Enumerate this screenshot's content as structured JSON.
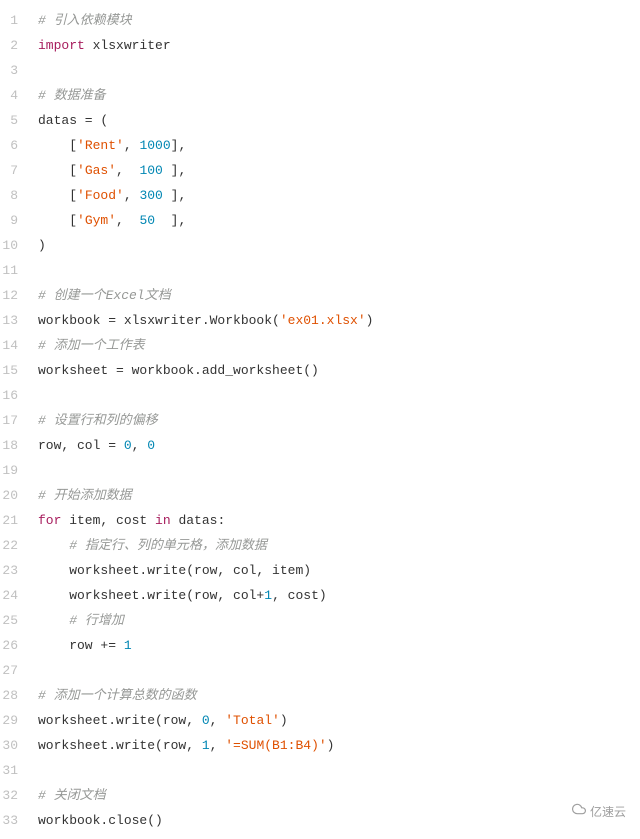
{
  "watermark": "亿速云",
  "lines": [
    {
      "n": 1,
      "tokens": [
        {
          "t": "# 引入依赖模块",
          "c": "c"
        }
      ]
    },
    {
      "n": 2,
      "tokens": [
        {
          "t": "import",
          "c": "k"
        },
        {
          "t": " xlsxwriter",
          "c": "p"
        }
      ]
    },
    {
      "n": 3,
      "tokens": []
    },
    {
      "n": 4,
      "tokens": [
        {
          "t": "# 数据准备",
          "c": "c"
        }
      ]
    },
    {
      "n": 5,
      "tokens": [
        {
          "t": "datas = (",
          "c": "p"
        }
      ]
    },
    {
      "n": 6,
      "tokens": [
        {
          "t": "    [",
          "c": "p"
        },
        {
          "t": "'Rent'",
          "c": "s"
        },
        {
          "t": ", ",
          "c": "p"
        },
        {
          "t": "1000",
          "c": "n"
        },
        {
          "t": "],",
          "c": "p"
        }
      ]
    },
    {
      "n": 7,
      "tokens": [
        {
          "t": "    [",
          "c": "p"
        },
        {
          "t": "'Gas'",
          "c": "s"
        },
        {
          "t": ",  ",
          "c": "p"
        },
        {
          "t": "100",
          "c": "n"
        },
        {
          "t": " ],",
          "c": "p"
        }
      ]
    },
    {
      "n": 8,
      "tokens": [
        {
          "t": "    [",
          "c": "p"
        },
        {
          "t": "'Food'",
          "c": "s"
        },
        {
          "t": ", ",
          "c": "p"
        },
        {
          "t": "300",
          "c": "n"
        },
        {
          "t": " ],",
          "c": "p"
        }
      ]
    },
    {
      "n": 9,
      "tokens": [
        {
          "t": "    [",
          "c": "p"
        },
        {
          "t": "'Gym'",
          "c": "s"
        },
        {
          "t": ",  ",
          "c": "p"
        },
        {
          "t": "50",
          "c": "n"
        },
        {
          "t": "  ],",
          "c": "p"
        }
      ]
    },
    {
      "n": 10,
      "tokens": [
        {
          "t": ")",
          "c": "p"
        }
      ]
    },
    {
      "n": 11,
      "tokens": []
    },
    {
      "n": 12,
      "tokens": [
        {
          "t": "# 创建一个Excel文档",
          "c": "c"
        }
      ]
    },
    {
      "n": 13,
      "tokens": [
        {
          "t": "workbook = xlsxwriter.Workbook(",
          "c": "p"
        },
        {
          "t": "'ex01.xlsx'",
          "c": "s"
        },
        {
          "t": ")",
          "c": "p"
        }
      ]
    },
    {
      "n": 14,
      "tokens": [
        {
          "t": "# 添加一个工作表",
          "c": "c"
        }
      ]
    },
    {
      "n": 15,
      "tokens": [
        {
          "t": "worksheet = workbook.add_worksheet()",
          "c": "p"
        }
      ]
    },
    {
      "n": 16,
      "tokens": []
    },
    {
      "n": 17,
      "tokens": [
        {
          "t": "# 设置行和列的偏移",
          "c": "c"
        }
      ]
    },
    {
      "n": 18,
      "tokens": [
        {
          "t": "row, col = ",
          "c": "p"
        },
        {
          "t": "0",
          "c": "n"
        },
        {
          "t": ", ",
          "c": "p"
        },
        {
          "t": "0",
          "c": "n"
        }
      ]
    },
    {
      "n": 19,
      "tokens": []
    },
    {
      "n": 20,
      "tokens": [
        {
          "t": "# 开始添加数据",
          "c": "c"
        }
      ]
    },
    {
      "n": 21,
      "tokens": [
        {
          "t": "for",
          "c": "k"
        },
        {
          "t": " item, cost ",
          "c": "p"
        },
        {
          "t": "in",
          "c": "k"
        },
        {
          "t": " datas:",
          "c": "p"
        }
      ]
    },
    {
      "n": 22,
      "tokens": [
        {
          "t": "    ",
          "c": "p"
        },
        {
          "t": "# 指定行、列的单元格，添加数据",
          "c": "c"
        }
      ]
    },
    {
      "n": 23,
      "tokens": [
        {
          "t": "    worksheet.write(row, col, item)",
          "c": "p"
        }
      ]
    },
    {
      "n": 24,
      "tokens": [
        {
          "t": "    worksheet.write(row, col+",
          "c": "p"
        },
        {
          "t": "1",
          "c": "n"
        },
        {
          "t": ", cost)",
          "c": "p"
        }
      ]
    },
    {
      "n": 25,
      "tokens": [
        {
          "t": "    ",
          "c": "p"
        },
        {
          "t": "# 行增加",
          "c": "c"
        }
      ]
    },
    {
      "n": 26,
      "tokens": [
        {
          "t": "    row += ",
          "c": "p"
        },
        {
          "t": "1",
          "c": "n"
        }
      ]
    },
    {
      "n": 27,
      "tokens": []
    },
    {
      "n": 28,
      "tokens": [
        {
          "t": "# 添加一个计算总数的函数",
          "c": "c"
        }
      ]
    },
    {
      "n": 29,
      "tokens": [
        {
          "t": "worksheet.write(row, ",
          "c": "p"
        },
        {
          "t": "0",
          "c": "n"
        },
        {
          "t": ", ",
          "c": "p"
        },
        {
          "t": "'Total'",
          "c": "s"
        },
        {
          "t": ")",
          "c": "p"
        }
      ]
    },
    {
      "n": 30,
      "tokens": [
        {
          "t": "worksheet.write(row, ",
          "c": "p"
        },
        {
          "t": "1",
          "c": "n"
        },
        {
          "t": ", ",
          "c": "p"
        },
        {
          "t": "'=SUM(B1:B4)'",
          "c": "s"
        },
        {
          "t": ")",
          "c": "p"
        }
      ]
    },
    {
      "n": 31,
      "tokens": []
    },
    {
      "n": 32,
      "tokens": [
        {
          "t": "# 关闭文档",
          "c": "c"
        }
      ]
    },
    {
      "n": 33,
      "tokens": [
        {
          "t": "workbook.close()",
          "c": "p"
        }
      ]
    }
  ]
}
